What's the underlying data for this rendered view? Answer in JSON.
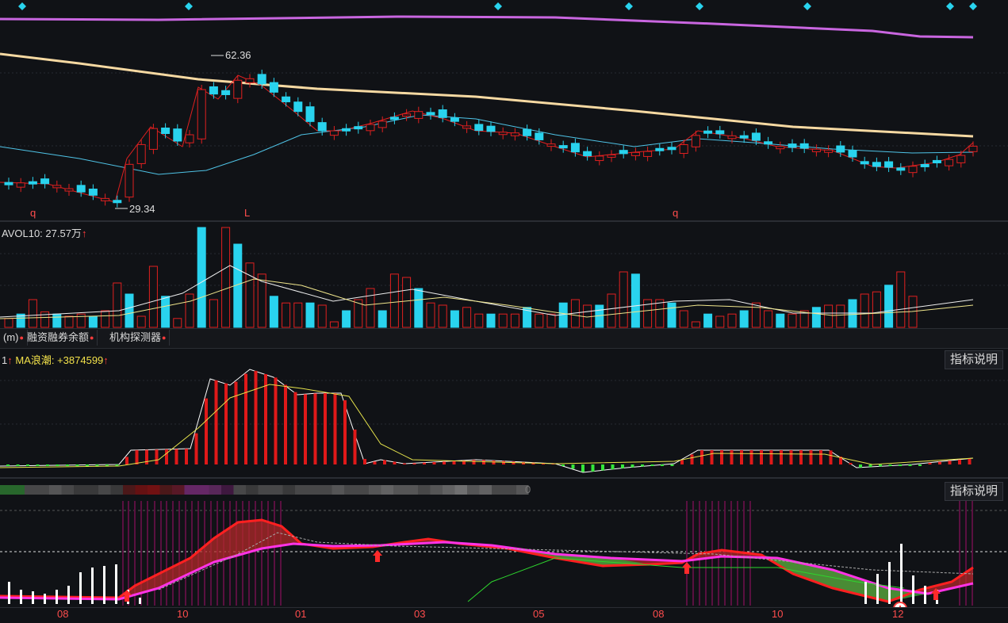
{
  "price_panel": {
    "high_label": "62.36",
    "low_label": "29.34",
    "markers": [
      "q",
      "L",
      "q"
    ]
  },
  "volume_panel": {
    "indicator_label": "AVOL10: 27.57万",
    "arrow": "↑"
  },
  "tabs": [
    {
      "label": "(m)"
    },
    {
      "label": "融资融券余额"
    },
    {
      "label": "机构探测器"
    }
  ],
  "wave_panel": {
    "prefix": "1",
    "indicator_label": "MA浪潮: +3874599",
    "arrow": "↑",
    "help_button": "指标说明"
  },
  "bottom_panel": {
    "help_button": "指标说明",
    "trailing_text": "0"
  },
  "x_axis": [
    "08",
    "10",
    "01",
    "03",
    "05",
    "08",
    "10",
    "12"
  ],
  "colors": {
    "background": "#101216",
    "up": "#e02020",
    "down": "#29d3ee",
    "ma_long": "#c966e0",
    "ma_mid": "#f6d9a2",
    "axis_text": "#ff4d4d"
  }
}
